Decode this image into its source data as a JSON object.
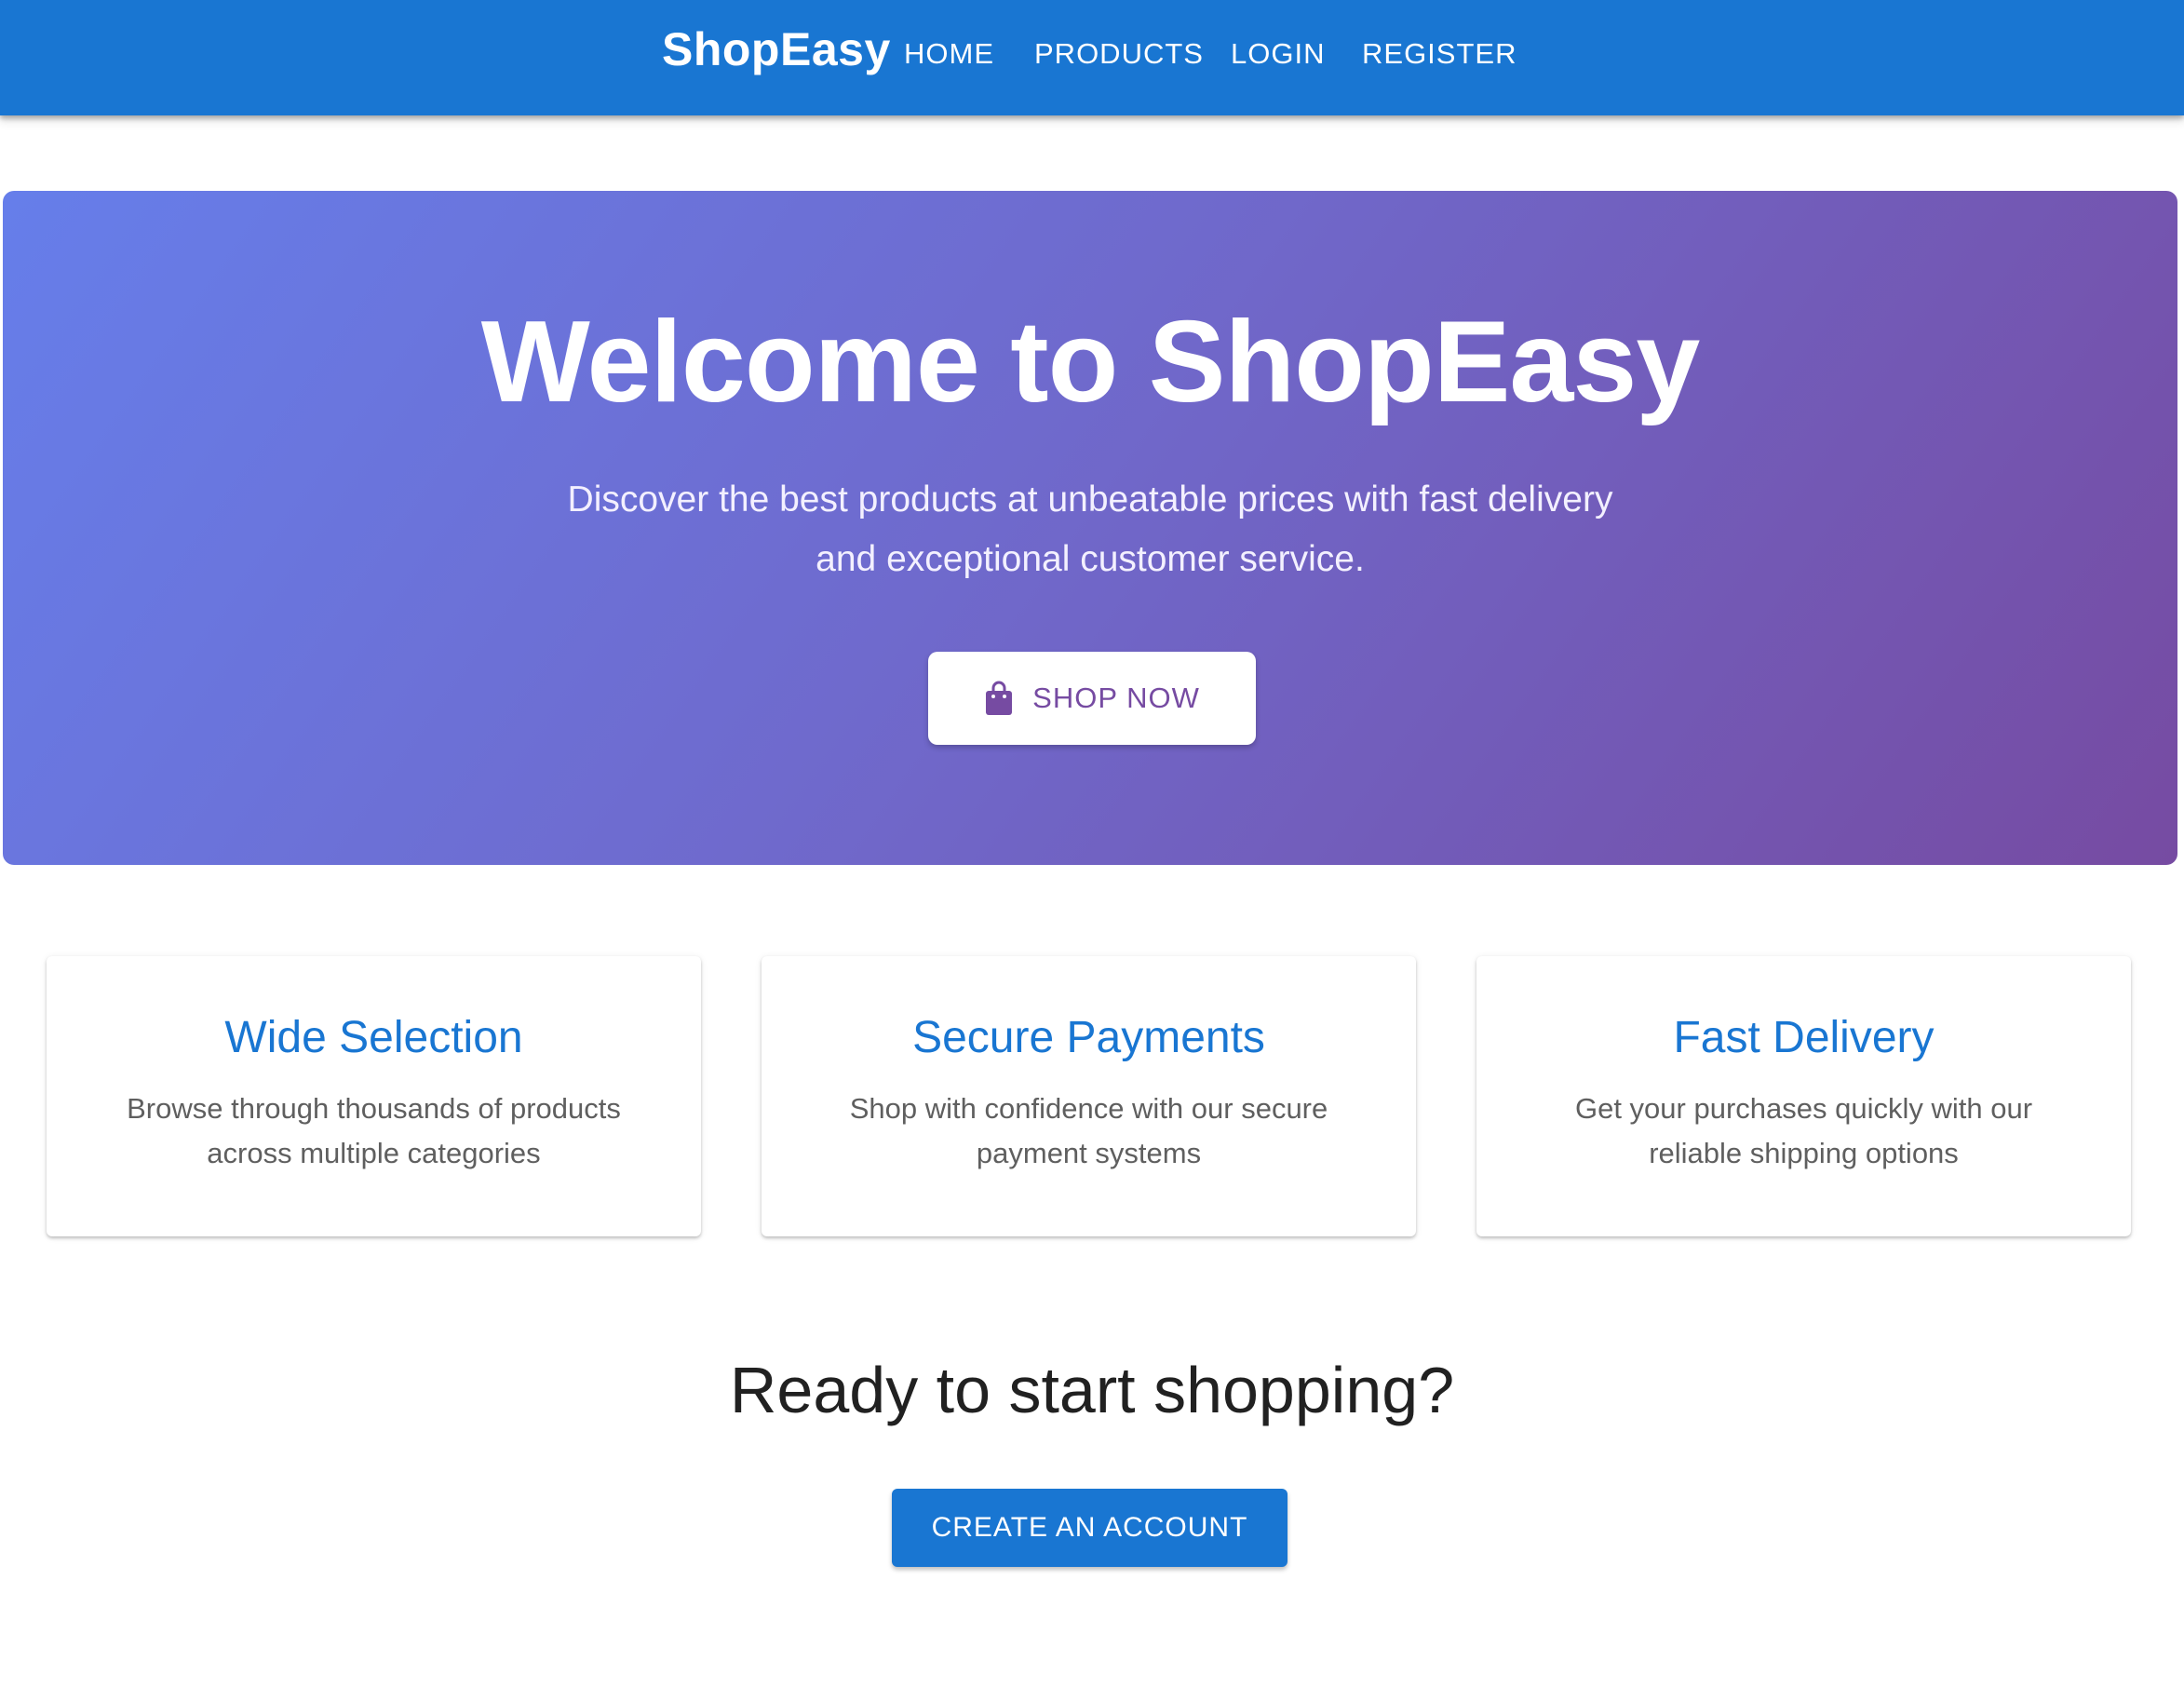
{
  "header": {
    "brand": "ShopEasy",
    "nav": [
      "HOME",
      "PRODUCTS",
      "LOGIN",
      "REGISTER"
    ]
  },
  "hero": {
    "title": "Welcome to ShopEasy",
    "subtitle_line1": "Discover the best products at unbeatable prices with fast delivery",
    "subtitle_line2": "and exceptional customer service.",
    "button_label": "SHOP NOW",
    "button_icon": "shopping-bag-icon"
  },
  "features": [
    {
      "title": "Wide Selection",
      "line1": "Browse through thousands of products",
      "line2": "across multiple categories"
    },
    {
      "title": "Secure Payments",
      "line1": "Shop with confidence with our secure",
      "line2": "payment systems"
    },
    {
      "title": "Fast Delivery",
      "line1": "Get your purchases quickly with our",
      "line2": "reliable shipping options"
    }
  ],
  "cta": {
    "title": "Ready to start shopping?",
    "button_label": "CREATE AN ACCOUNT"
  },
  "colors": {
    "primary": "#1976d2",
    "hero_gradient_start": "#667eea",
    "hero_gradient_end": "#764ba2",
    "accent_purple": "#764ba2",
    "background": "#ffffff"
  }
}
